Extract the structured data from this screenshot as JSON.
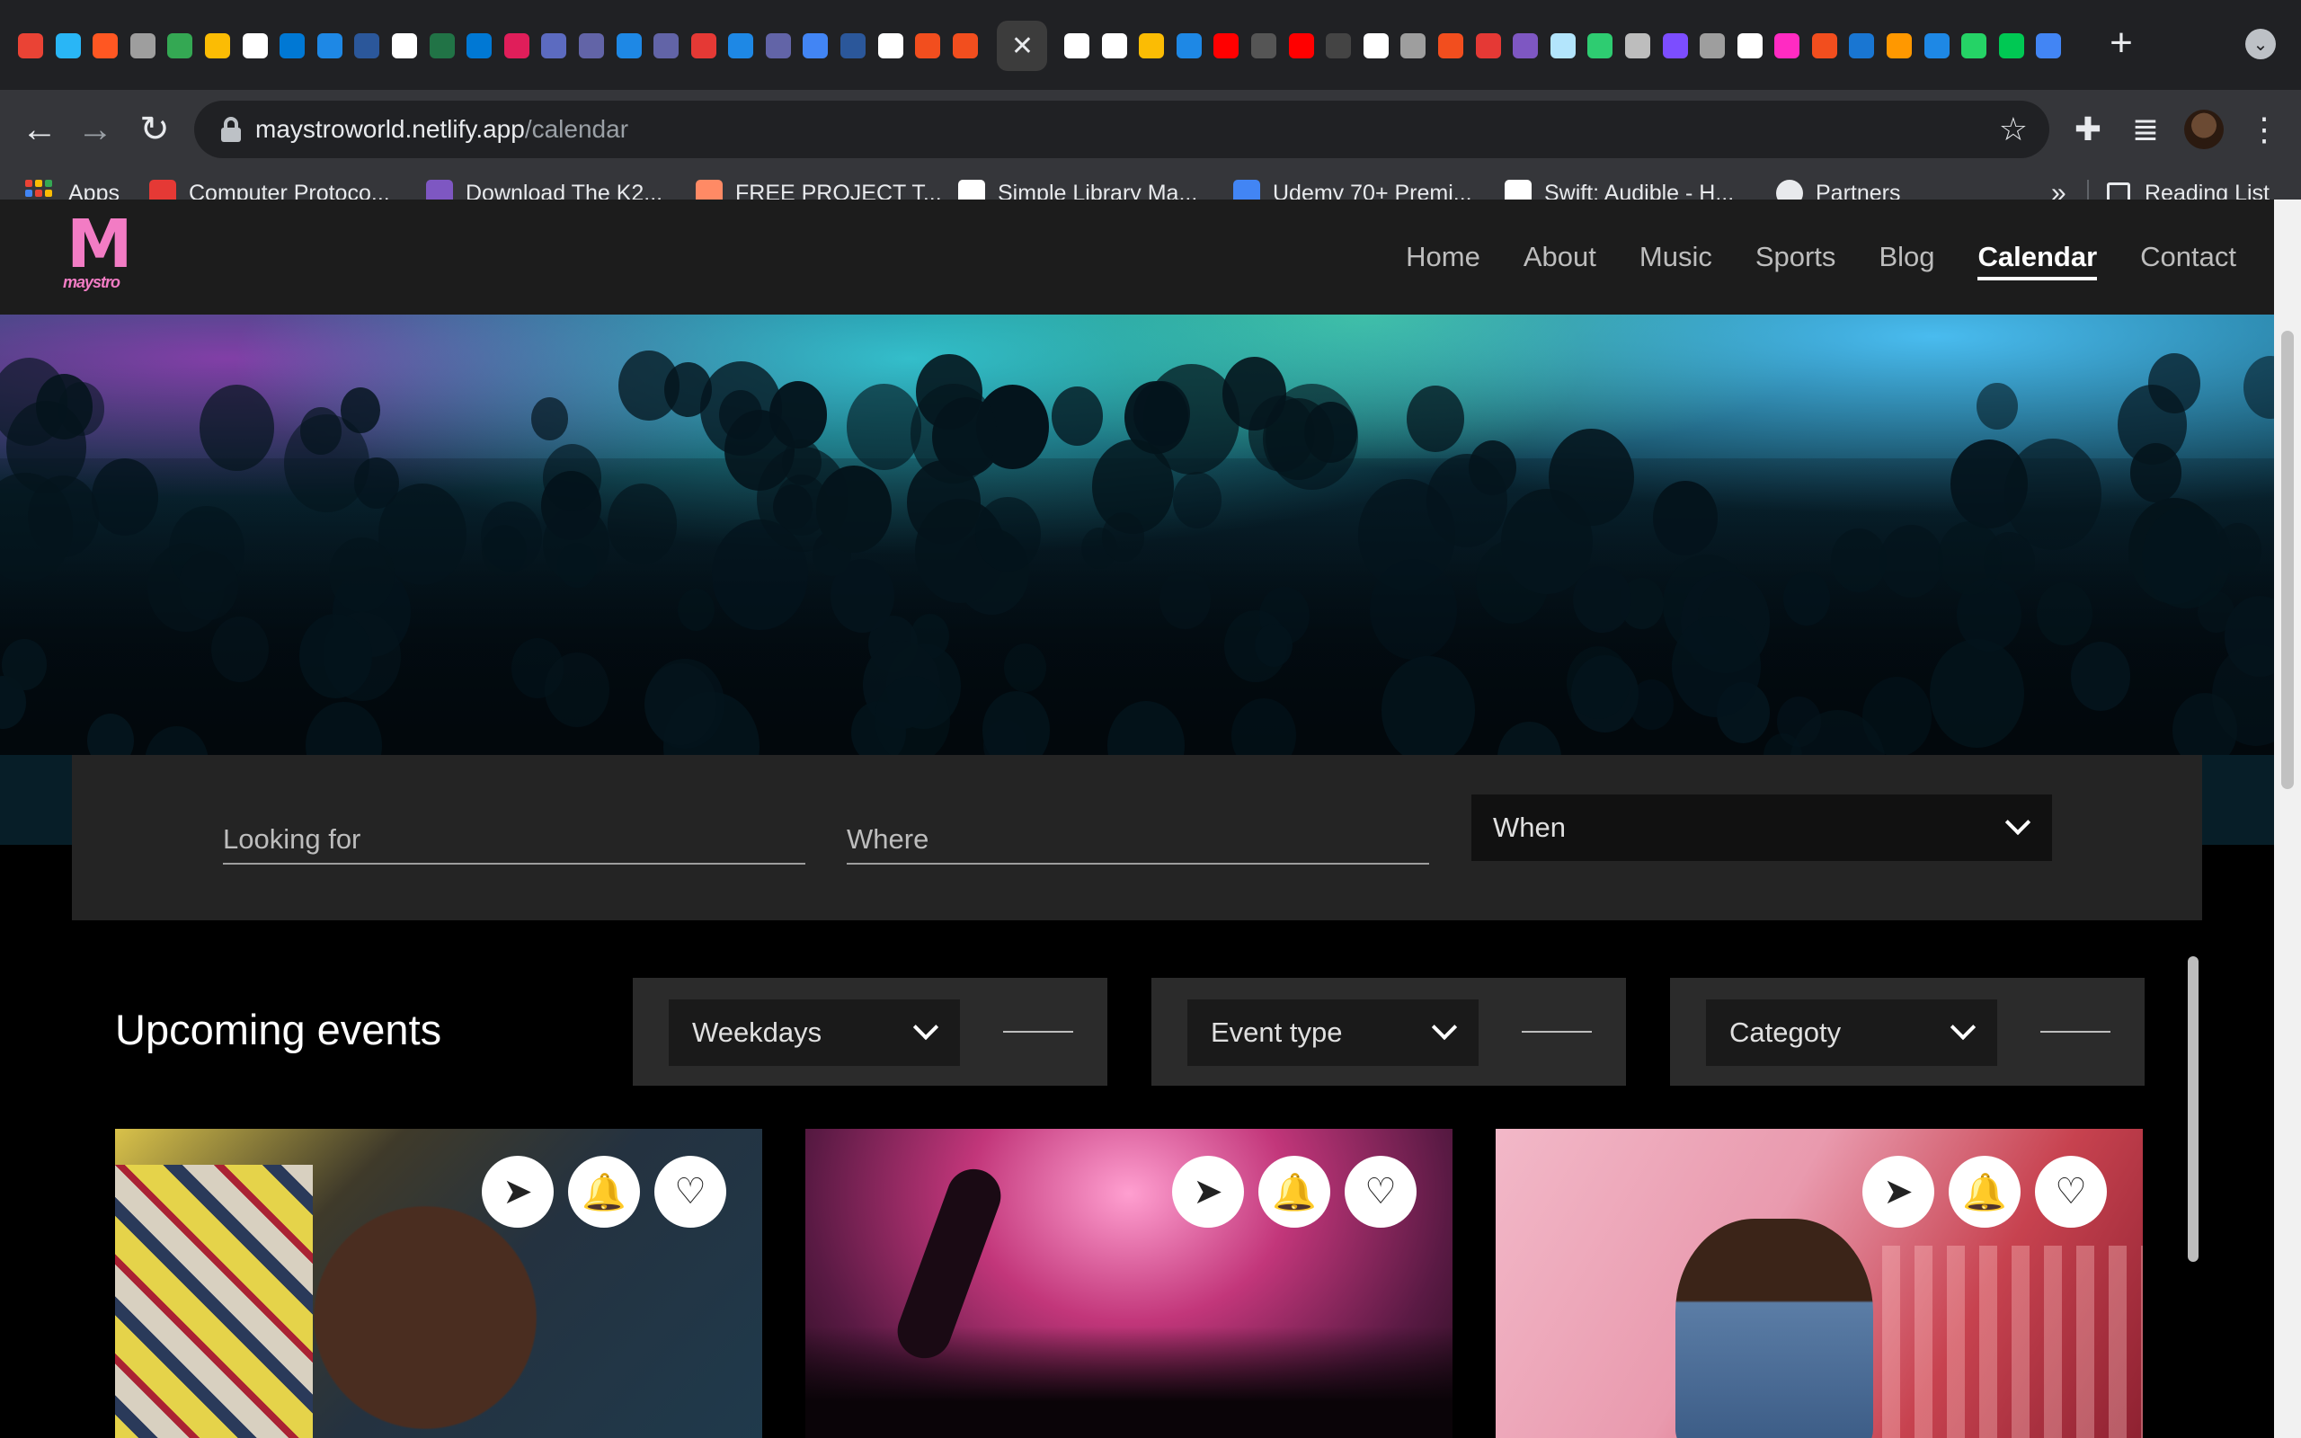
{
  "browser": {
    "url_host": "maystroworld.netlify.app",
    "url_path": "/calendar",
    "close_tab_glyph": "✕",
    "new_tab_glyph": "+",
    "tab_menu_glyph": "⌄",
    "back_glyph": "←",
    "forward_glyph": "→",
    "reload_glyph": "↻",
    "bookmark_star_glyph": "☆",
    "extensions_glyph": "✚",
    "media_glyph": "≣",
    "menu_glyph": "⋮",
    "more_bookmarks_glyph": "»",
    "bookmarks": [
      {
        "label": "Apps",
        "icon": "apps-grid-icon"
      },
      {
        "label": "Computer Protoco...",
        "icon": "red-bookmark-icon",
        "color": "#e53935"
      },
      {
        "label": "Download The K2...",
        "icon": "purple-reel-icon",
        "color": "#7e57c2"
      },
      {
        "label": "FREE PROJECT T...",
        "icon": "orange-project-icon",
        "color": "#ff8a65"
      },
      {
        "label": "Simple Library Ma...",
        "icon": "k-logo-icon",
        "color": "#ffffff"
      },
      {
        "label": "Udemy 70+ Premi...",
        "icon": "google-g-icon",
        "color": "#4285f4"
      },
      {
        "label": "Swift: Audible - H...",
        "icon": "lb-logo-icon",
        "color": "#ffffff"
      },
      {
        "label": "Partners",
        "icon": "globe-icon",
        "color": "#e8eaed"
      }
    ],
    "reading_list": "Reading List",
    "tab_icon_colors": [
      "#ea4335",
      "#29b6f6",
      "#ff5722",
      "#9e9e9e",
      "#34a853",
      "#fbbc04",
      "#ffffff",
      "#0078d4",
      "#1e88e5",
      "#2b579a",
      "#ffffff",
      "#217346",
      "#0078d4",
      "#e01e5a",
      "#5c6bc0",
      "#6264a7",
      "#1e88e5",
      "#6264a7",
      "#e53935",
      "#1e88e5",
      "#6264a7",
      "#4285f4",
      "#2b579a",
      "#ffffff",
      "#f24e1e",
      "#f24e1e"
    ],
    "tab_icon_colors_right": [
      "#ffffff",
      "#ffffff",
      "#fbbc04",
      "#1e88e5",
      "#ff0000",
      "#555555",
      "#ff0000",
      "#444444",
      "#ffffff",
      "#9e9e9e",
      "#f24e1e",
      "#e53935",
      "#7e57c2",
      "#b3e5fc",
      "#2ecc71",
      "#bdbdbd",
      "#7c4dff",
      "#9e9e9e",
      "#ffffff",
      "#ff2bc2",
      "#f24e1e",
      "#1976d2",
      "#ff9800",
      "#1e88e5",
      "#25d366",
      "#00c853",
      "#4285f4"
    ]
  },
  "site": {
    "logo_letter": "M",
    "logo_text": "maystro",
    "nav": [
      "Home",
      "About",
      "Music",
      "Sports",
      "Blog",
      "Calendar",
      "Contact"
    ],
    "active_nav": "Calendar"
  },
  "search": {
    "looking_for_placeholder": "Looking for",
    "where_placeholder": "Where",
    "when_label": "When"
  },
  "events": {
    "heading": "Upcoming events",
    "filters": [
      "Weekdays",
      "Event type",
      "Categoty"
    ],
    "card_action_glyphs": [
      "➤",
      "🔔",
      "♡"
    ]
  }
}
